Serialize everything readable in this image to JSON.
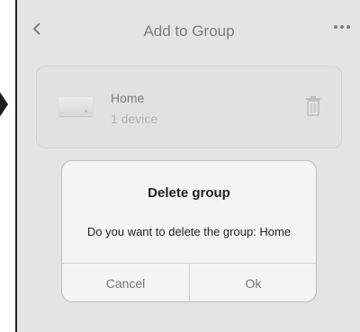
{
  "header": {
    "title": "Add to Group",
    "back_icon": "chevron-left-icon",
    "more_icon": "more-horizontal-icon"
  },
  "group": {
    "name": "Home",
    "device_count": "1 device",
    "device_icon": "device-icon",
    "delete_icon": "trash-icon"
  },
  "dialog": {
    "title": "Delete group",
    "message": "Do you want to delete the group: Home",
    "cancel_label": "Cancel",
    "ok_label": "Ok"
  }
}
